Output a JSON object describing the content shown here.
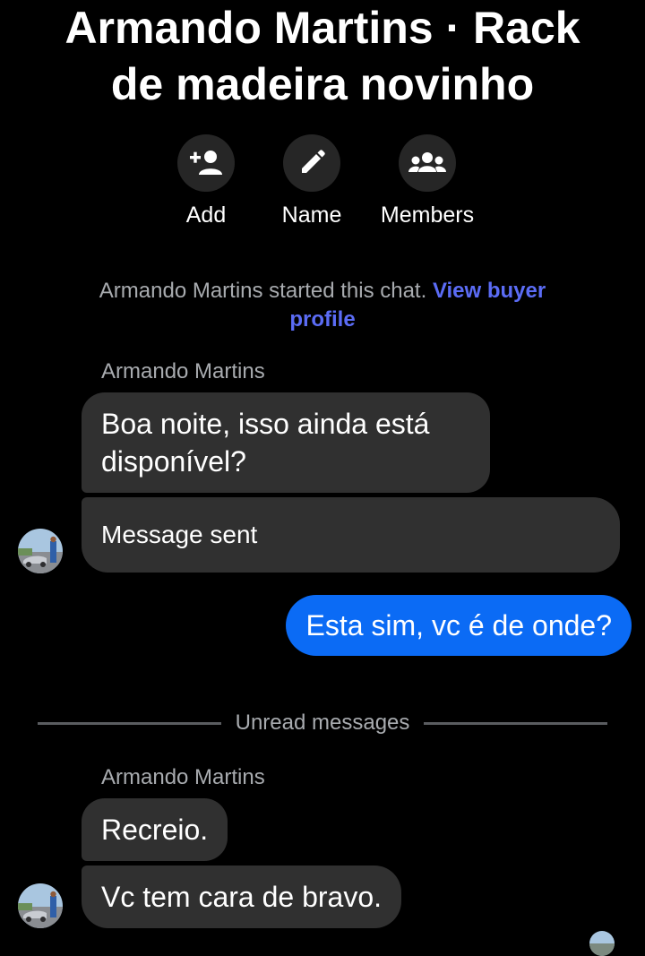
{
  "header": {
    "title_line1": "Armando Martins · Rack",
    "title_line2": "de madeira novinho"
  },
  "actions": [
    {
      "label": "Add",
      "icon": "add-person-icon"
    },
    {
      "label": "Name",
      "icon": "pencil-icon"
    },
    {
      "label": "Members",
      "icon": "members-icon"
    }
  ],
  "system_note": {
    "text": "Armando Martins started this chat.",
    "link": "View buyer profile"
  },
  "groups": [
    {
      "sender": "Armando Martins",
      "messages": [
        "Boa noite, isso ainda está disponível?",
        "Message sent"
      ]
    },
    {
      "sender": "Armando Martins",
      "messages": [
        "Recreio.",
        "Vc tem cara de bravo."
      ]
    }
  ],
  "outgoing": [
    {
      "text": "Esta sim, vc é de onde?"
    }
  ],
  "divider": {
    "label": "Unread messages"
  },
  "colors": {
    "background": "#000000",
    "incoming_bubble": "#303030",
    "outgoing_bubble": "#0b6bf5",
    "link": "#5b6cf5",
    "muted_text": "#a8abaf"
  }
}
